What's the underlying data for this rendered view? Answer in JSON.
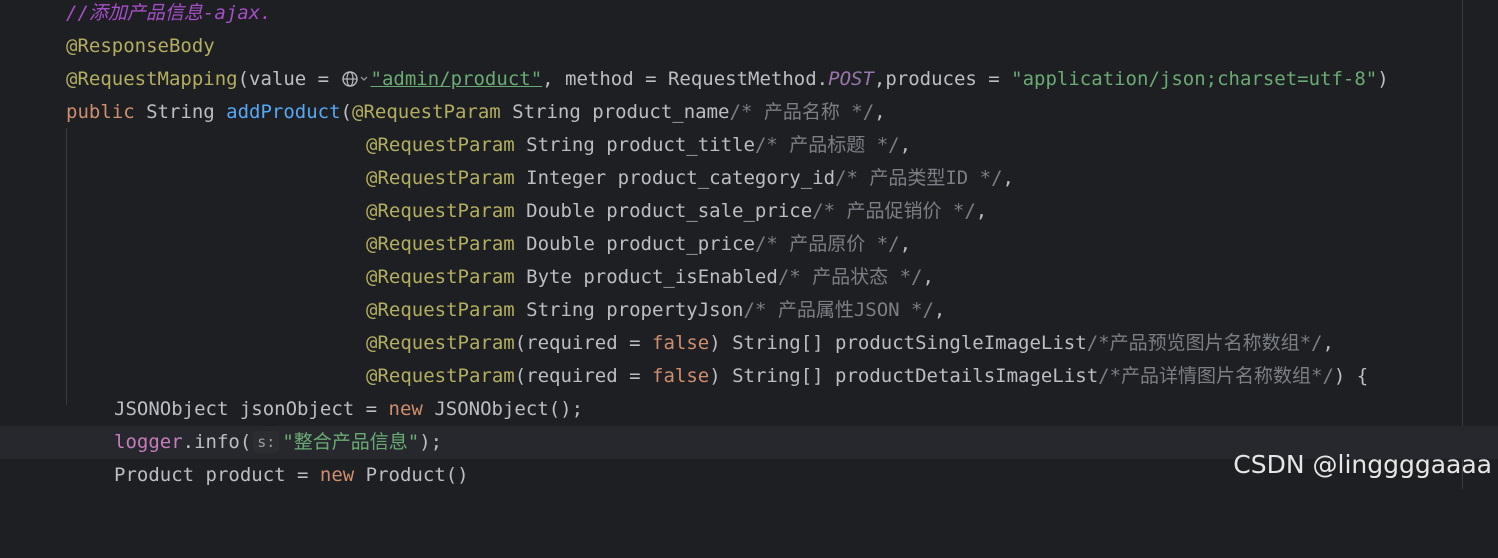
{
  "code": {
    "l1": {
      "comment": "//添加产品信息-ajax."
    },
    "l2": {
      "annotation": "@ResponseBody"
    },
    "l3": {
      "annotation": "@RequestMapping",
      "p1": "(value = ",
      "url": "\"admin/product\"",
      "p2": ", method = RequestMethod.",
      "post": "POST",
      "p3": ",produces = ",
      "produces": "\"application/json;charset=utf-8\"",
      "p4": ")"
    },
    "l4": {
      "kw_public": "public",
      "p1": " String ",
      "method": "addProduct",
      "p2": "(",
      "ann": "@RequestParam",
      "p3": " String product_name",
      "comment": "/* 产品名称 */",
      "p4": ","
    },
    "params": [
      {
        "ann": "@RequestParam",
        "decl": " String product_title",
        "comment": "/* 产品标题 */",
        "end": ","
      },
      {
        "ann": "@RequestParam",
        "decl": " Integer product_category_id",
        "comment": "/* 产品类型ID */",
        "end": ","
      },
      {
        "ann": "@RequestParam",
        "decl": " Double product_sale_price",
        "comment": "/* 产品促销价 */",
        "end": ","
      },
      {
        "ann": "@RequestParam",
        "decl": " Double product_price",
        "comment": "/* 产品原价 */",
        "end": ","
      },
      {
        "ann": "@RequestParam",
        "decl": " Byte product_isEnabled",
        "comment": "/* 产品状态 */",
        "end": ","
      },
      {
        "ann": "@RequestParam",
        "decl": " String propertyJson",
        "comment": "/* 产品属性JSON */",
        "end": ","
      }
    ],
    "l11": {
      "ann": "@RequestParam",
      "p1": "(required = ",
      "kw": "false",
      "p2": ") String[] productSingleImageList",
      "comment": "/*产品预览图片名称数组*/",
      "end": ","
    },
    "l12": {
      "ann": "@RequestParam",
      "p1": "(required = ",
      "kw": "false",
      "p2": ") String[] productDetailsImageList",
      "comment": "/*产品详情图片名称数组*/",
      "end": ") {"
    },
    "l13": {
      "p1": "JSONObject jsonObject = ",
      "kw": "new",
      "p2": " JSONObject();"
    },
    "l14": {
      "field": "logger",
      "p1": ".info(",
      "hint": "s:",
      "str": "\"整合产品信息\"",
      "p2": ");"
    },
    "l15": {
      "p1": "Product product = ",
      "kw": "new",
      "p2": " Product()"
    }
  },
  "watermark": "CSDN @linggggaaaa",
  "icons": {
    "url_marker": "globe-icon",
    "url_dropdown": "chevron-down-icon"
  },
  "colors": {
    "background": "#1e1f22",
    "annotation": "#b3ae60",
    "keyword": "#cf8e6d",
    "string": "#6aab73",
    "method_declaration": "#56a8f5",
    "comment": "#7a7e85",
    "todo_comment": "#a64fc8",
    "static_field": "#9876aa",
    "field": "#c77dbb"
  }
}
